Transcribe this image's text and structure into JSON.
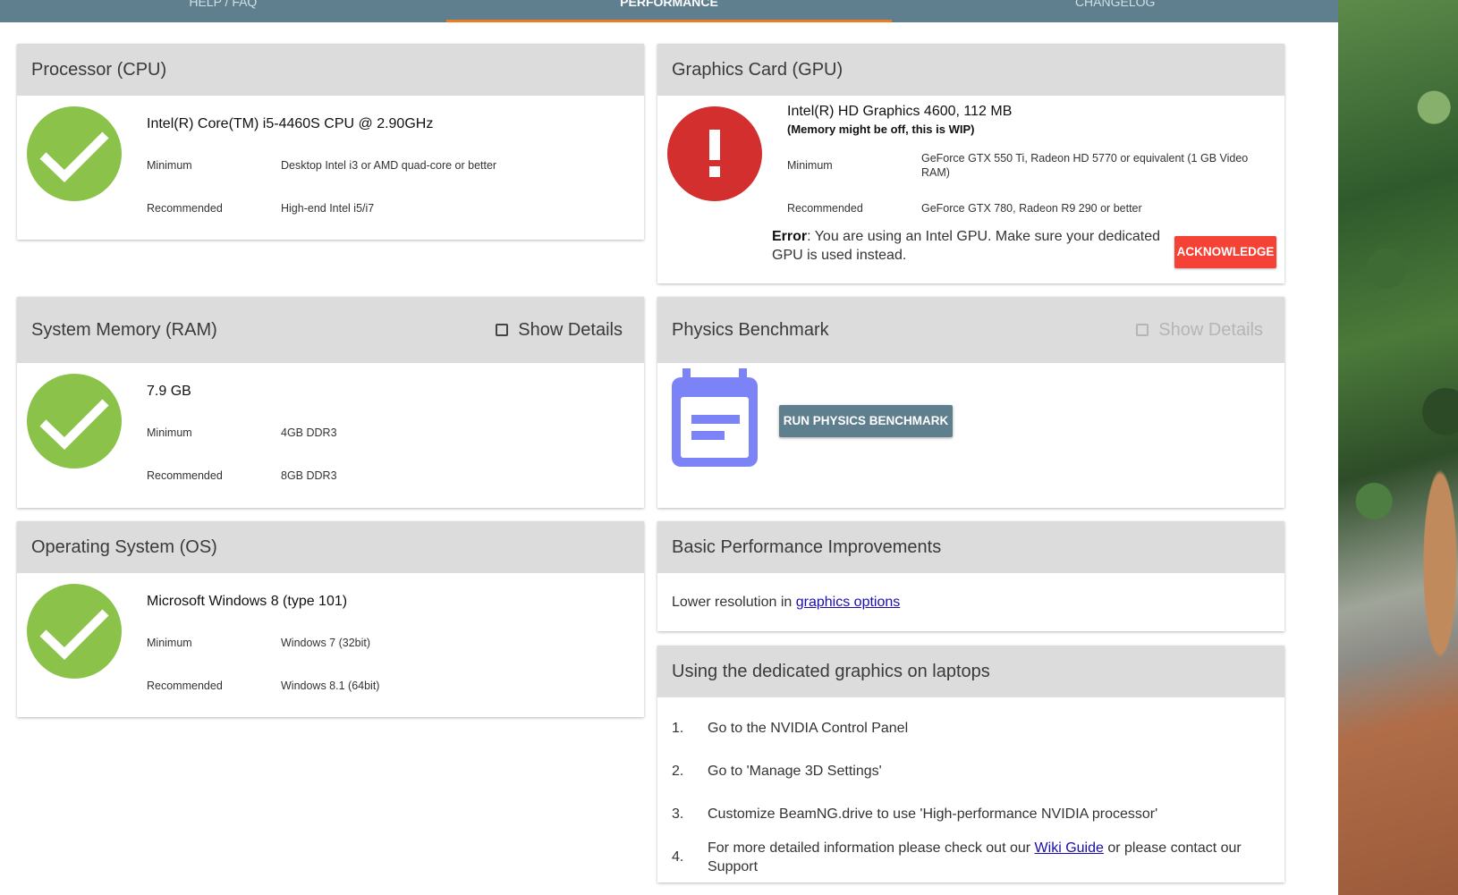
{
  "tabs": [
    {
      "label": "HELP / FAQ",
      "active": false
    },
    {
      "label": "PERFORMANCE",
      "active": true
    },
    {
      "label": "CHANGELOG",
      "active": false
    }
  ],
  "cpu": {
    "title": "Processor (CPU)",
    "status": "ok",
    "name": "Intel(R) Core(TM) i5-4460S CPU @ 2.90GHz",
    "minimum_label": "Minimum",
    "minimum": "Desktop Intel i3 or AMD quad-core or better",
    "recommended_label": "Recommended",
    "recommended": "High-end Intel i5/i7"
  },
  "gpu": {
    "title": "Graphics Card (GPU)",
    "status": "error",
    "name": "Intel(R) HD Graphics 4600, 112 MB",
    "note": "(Memory might be off, this is WIP)",
    "minimum_label": "Minimum",
    "minimum": "GeForce GTX 550 Ti, Radeon HD 5770 or equivalent (1 GB Video RAM)",
    "recommended_label": "Recommended",
    "recommended": "GeForce GTX 780, Radeon R9 290 or better",
    "error_label": "Error",
    "error_message": ": You are using an Intel GPU. Make sure your dedicated GPU is used instead.",
    "acknowledge_label": "Acknowledge"
  },
  "ram": {
    "title": "System Memory (RAM)",
    "show_details_label": "Show Details",
    "status": "ok",
    "name": "7.9 GB",
    "minimum_label": "Minimum",
    "minimum": "4GB DDR3",
    "recommended_label": "Recommended",
    "recommended": "8GB DDR3"
  },
  "physics": {
    "title": "Physics Benchmark",
    "show_details_label": "Show Details",
    "run_label": "Run Physics Benchmark",
    "icon": "calendar-note-icon",
    "icon_color": "#7b83f7"
  },
  "os": {
    "title": "Operating System (OS)",
    "status": "ok",
    "name": "Microsoft Windows 8 (type 101)",
    "minimum_label": "Minimum",
    "minimum": "Windows 7 (32bit)",
    "recommended_label": "Recommended",
    "recommended": "Windows 8.1 (64bit)"
  },
  "basic": {
    "title": "Basic Performance Improvements",
    "text": "Lower resolution in ",
    "link": "graphics options"
  },
  "laptops": {
    "title": "Using the dedicated graphics on laptops",
    "steps": [
      {
        "num": "1.",
        "text": "Go to the NVIDIA Control Panel"
      },
      {
        "num": "2.",
        "text": "Go to 'Manage 3D Settings'"
      },
      {
        "num": "3.",
        "text": "Customize BeamNG.drive to use 'High-performance NVIDIA processor'"
      },
      {
        "num": "4.",
        "text_before": "For more detailed information please check out our ",
        "link": "Wiki Guide",
        "text_after": " or please contact our Support"
      }
    ]
  },
  "colors": {
    "accent": "#ee7a22",
    "ok": "#8bc34a",
    "error": "#d32f2f",
    "header_bar": "#5f7f8f"
  }
}
